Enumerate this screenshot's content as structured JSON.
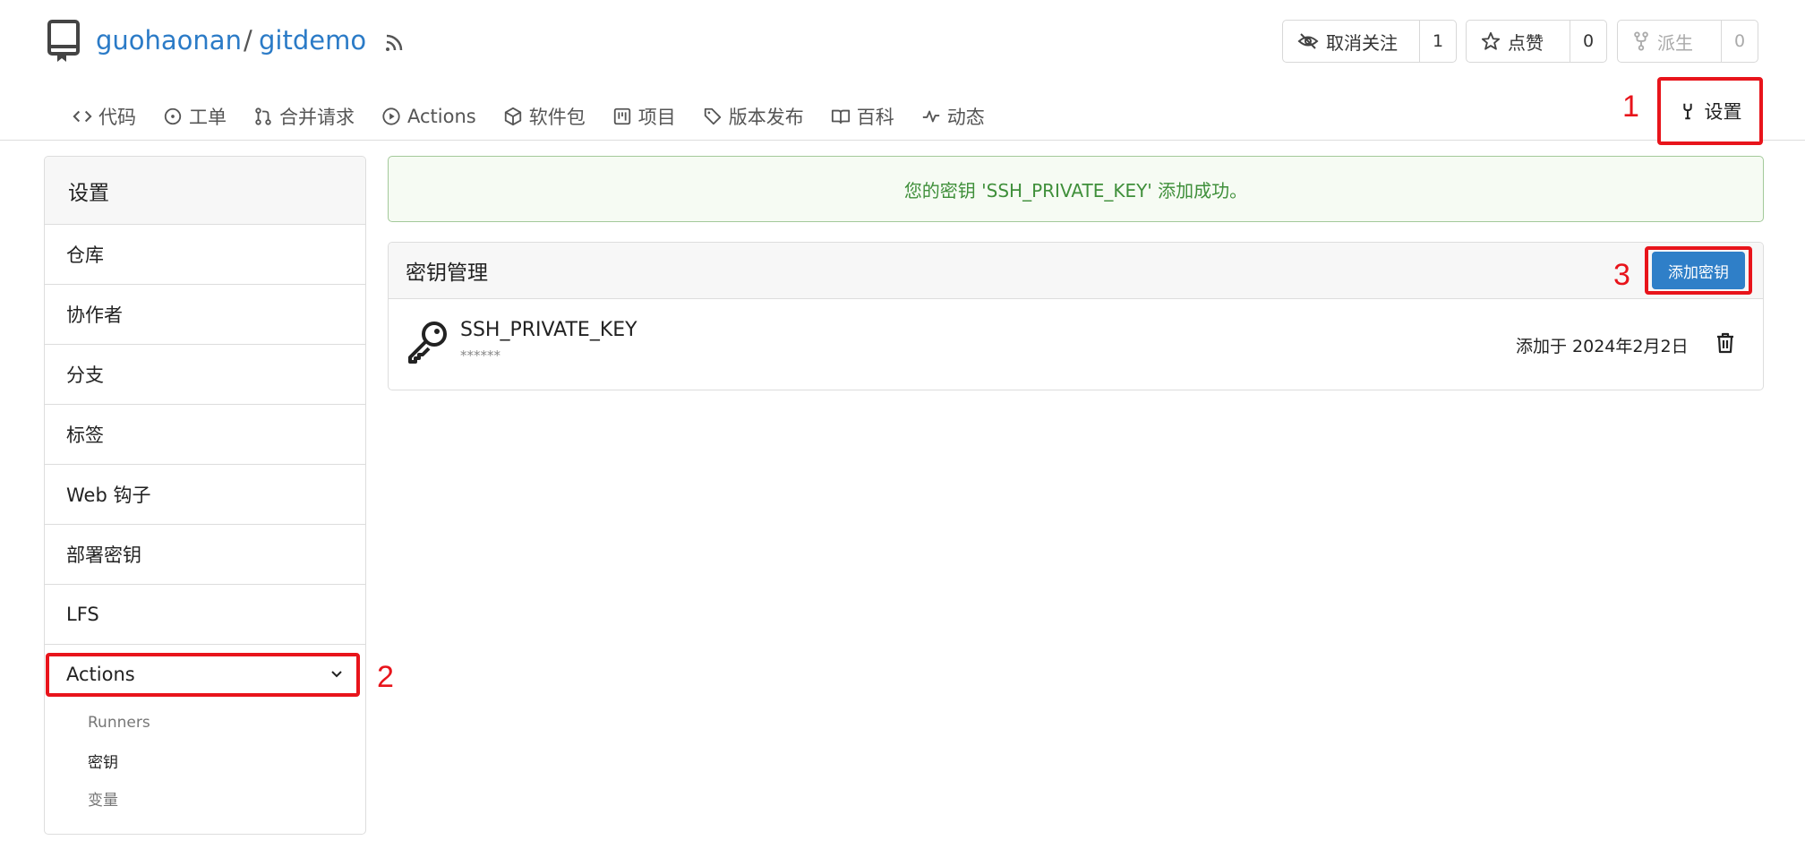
{
  "repo": {
    "owner": "guohaonan",
    "separator": "/",
    "name": "gitdemo"
  },
  "actions": {
    "unwatch_label": "取消关注",
    "unwatch_count": "1",
    "star_label": "点赞",
    "star_count": "0",
    "fork_label": "派生",
    "fork_count": "0"
  },
  "tabs": [
    {
      "label": "代码",
      "icon": "code-icon"
    },
    {
      "label": "工单",
      "icon": "issue-icon"
    },
    {
      "label": "合并请求",
      "icon": "pull-request-icon"
    },
    {
      "label": "Actions",
      "icon": "play-icon"
    },
    {
      "label": "软件包",
      "icon": "package-icon"
    },
    {
      "label": "项目",
      "icon": "project-icon"
    },
    {
      "label": "版本发布",
      "icon": "tag-icon"
    },
    {
      "label": "百科",
      "icon": "book-icon"
    },
    {
      "label": "动态",
      "icon": "pulse-icon"
    }
  ],
  "settings_tab": {
    "label": "设置",
    "icon": "tools-icon"
  },
  "annotations": {
    "one": "1",
    "two": "2",
    "three": "3"
  },
  "annotation_color": "#e8141b",
  "sidebar": {
    "title": "设置",
    "items": [
      "仓库",
      "协作者",
      "分支",
      "标签",
      "Web 钩子",
      "部署密钥",
      "LFS"
    ],
    "actions_label": "Actions",
    "sub_items": [
      "Runners",
      "密钥",
      "变量"
    ]
  },
  "flash": {
    "message": "您的密钥 'SSH_PRIVATE_KEY' 添加成功。"
  },
  "secrets": {
    "title": "密钥管理",
    "add_button": "添加密钥",
    "item": {
      "name": "SSH_PRIVATE_KEY",
      "mask": "******",
      "added": "添加于 2024年2月2日"
    }
  },
  "colors": {
    "link": "#2b7bc7",
    "primary_button": "#2f7fc8",
    "success_text": "#3f8f3a"
  }
}
